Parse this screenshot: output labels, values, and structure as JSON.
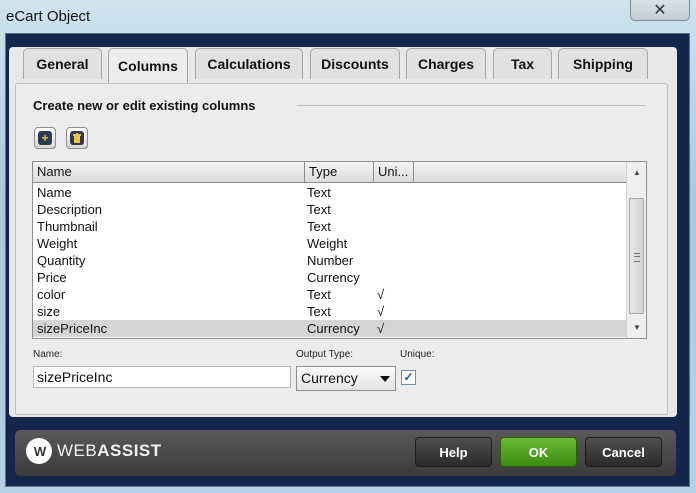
{
  "window": {
    "title": "eCart Object",
    "close_symbol": "✕"
  },
  "tabs": [
    {
      "label": "General"
    },
    {
      "label": "Columns"
    },
    {
      "label": "Calculations"
    },
    {
      "label": "Discounts"
    },
    {
      "label": "Charges"
    },
    {
      "label": "Tax"
    },
    {
      "label": "Shipping"
    }
  ],
  "active_tab": "Columns",
  "section": {
    "title": "Create new or edit existing columns"
  },
  "toolbar": {
    "add_icon": "plus-icon",
    "delete_icon": "trash-icon",
    "add_glyph": "+",
    "delete_glyph": "🗑"
  },
  "table": {
    "headers": {
      "name": "Name",
      "type": "Type",
      "unique": "Uni..."
    },
    "rows": [
      {
        "name": "Name",
        "type": "Text",
        "unique": ""
      },
      {
        "name": "Description",
        "type": "Text",
        "unique": ""
      },
      {
        "name": "Thumbnail",
        "type": "Text",
        "unique": ""
      },
      {
        "name": "Weight",
        "type": "Weight",
        "unique": ""
      },
      {
        "name": "Quantity",
        "type": "Number",
        "unique": ""
      },
      {
        "name": "Price",
        "type": "Currency",
        "unique": ""
      },
      {
        "name": "color",
        "type": "Text",
        "unique": "√"
      },
      {
        "name": "size",
        "type": "Text",
        "unique": "√"
      },
      {
        "name": "sizePriceInc",
        "type": "Currency",
        "unique": "√"
      }
    ],
    "selected_row": "sizePriceInc",
    "scroll_up": "▲",
    "scroll_down": "▼"
  },
  "form": {
    "name_label": "Name:",
    "name_value": "sizePriceInc",
    "output_type_label": "Output Type:",
    "output_type_value": "Currency",
    "unique_label": "Unique:",
    "unique_checked": true,
    "check_glyph": "✓"
  },
  "footer": {
    "logo_glyph": "W",
    "brand_light": "WEB",
    "brand_bold": "ASSIST",
    "help_label": "Help",
    "ok_label": "OK",
    "cancel_label": "Cancel"
  },
  "colors": {
    "ok_button": "#4fa322",
    "dialog_frame": "#14264b",
    "footer": "#444444"
  }
}
